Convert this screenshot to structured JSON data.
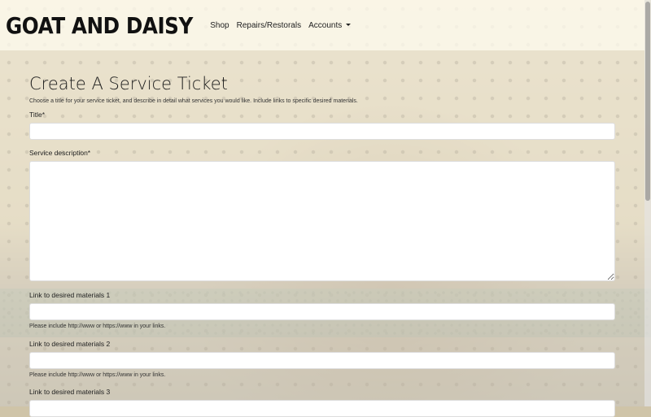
{
  "brand": "GOAT AND DAISY",
  "nav": {
    "shop": "Shop",
    "repairs": "Repairs/Restorals",
    "accounts": "Accounts"
  },
  "form": {
    "title": "Create A Service Ticket",
    "intro": "Choose a title for your service ticket, and describe in detail what services you would like. Include links to specific desired materials.",
    "title_label": "Title*",
    "description_label": "Service description*",
    "link1_label": "Link to desired materials 1",
    "link2_label": "Link to desired materials 2",
    "link3_label": "Link to desired materials 3",
    "link_help": "Please include http://www or https://www in your links.",
    "title_value": "",
    "description_value": "",
    "link1_value": "",
    "link2_value": "",
    "link3_value": ""
  },
  "icons": {
    "accounts_dropdown": "caret-down-icon"
  }
}
